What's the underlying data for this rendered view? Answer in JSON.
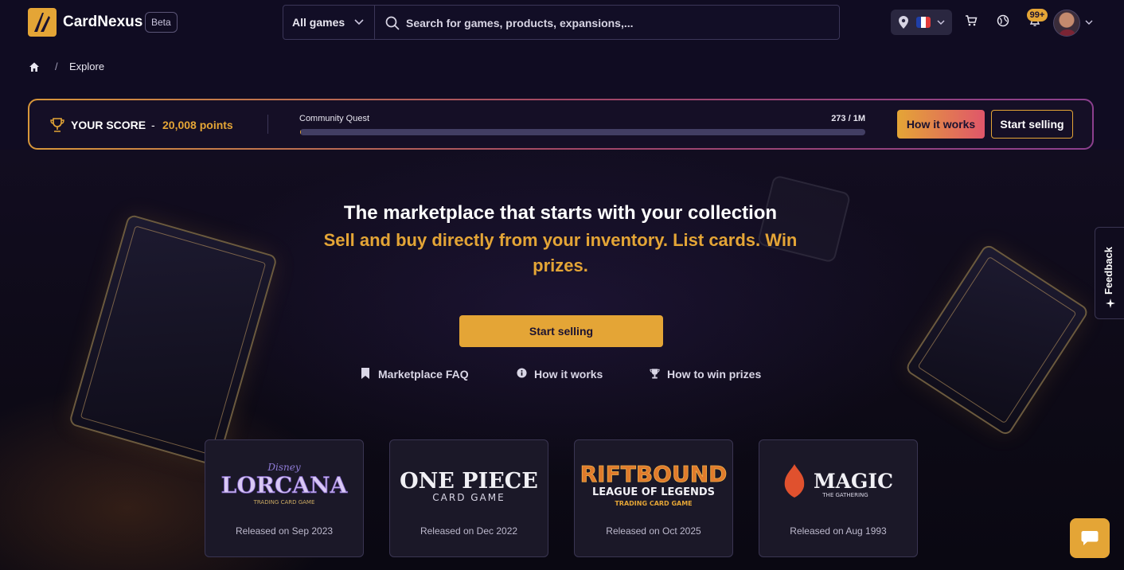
{
  "header": {
    "brand": "CardNexus",
    "beta_label": "Beta",
    "games_select": "All games",
    "search_placeholder": "Search for games, products, expansions,...",
    "notifications_badge": "99+",
    "flag_colors": [
      "#1f3fa8",
      "#ffffff",
      "#e23b3b"
    ]
  },
  "breadcrumb": {
    "separator": "/",
    "current": "Explore"
  },
  "score": {
    "label": "YOUR SCORE",
    "separator": "-",
    "points": "20,008 points",
    "quest_label": "Community Quest",
    "quest_count": "273 / 1M",
    "quest_progress": 0.000273,
    "how_button": "How it works",
    "sell_button": "Start selling"
  },
  "hero": {
    "title": "The marketplace that starts with your collection",
    "subtitle": "Sell and buy directly from your inventory. List cards. Win prizes.",
    "cta": "Start selling",
    "links": [
      {
        "label": "Marketplace FAQ",
        "icon": "bookmark-icon"
      },
      {
        "label": "How it works",
        "icon": "info-icon"
      },
      {
        "label": "How to win prizes",
        "icon": "trophy-icon"
      }
    ]
  },
  "games": [
    {
      "logo_text": "LORCANA",
      "logo_top": "Disney",
      "logo_bottom": "TRADING CARD GAME",
      "release": "Released on Sep 2023"
    },
    {
      "logo_text": "ONE PIECE",
      "logo_bottom": "CARD GAME",
      "release": "Released on Dec 2022"
    },
    {
      "logo_text": "RIFTBOUND",
      "logo_middle": "LEAGUE OF LEGENDS",
      "logo_bottom": "TRADING CARD GAME",
      "release": "Released on Oct 2025"
    },
    {
      "logo_text": "MAGIC",
      "logo_bottom": "THE GATHERING",
      "release": "Released on Aug 1993"
    }
  ],
  "feedback_label": "Feedback",
  "colors": {
    "accent": "#e4a536",
    "background": "#0f0b1c"
  }
}
